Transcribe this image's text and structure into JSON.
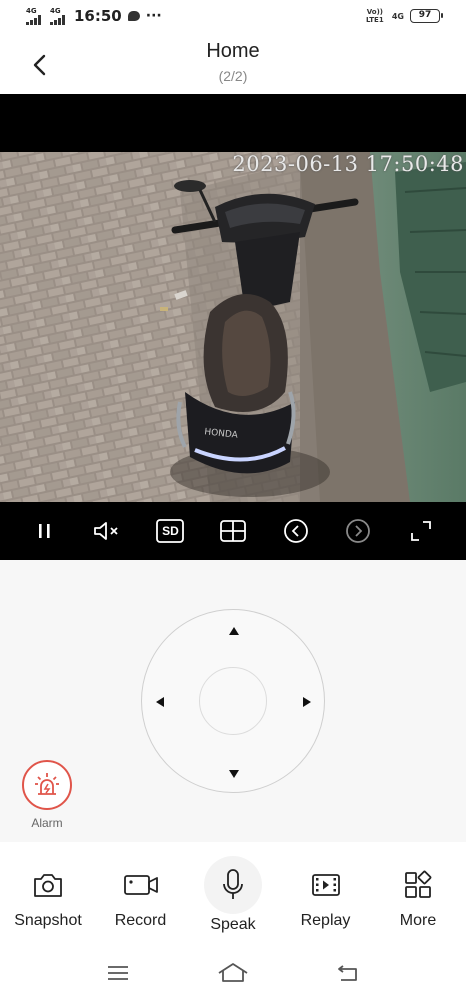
{
  "status_bar": {
    "signal1_label": "4G",
    "signal2_label": "4G",
    "time": "16:50",
    "more_dots": "···",
    "volte_label": "Vo)) LTE1",
    "net_label": "4G",
    "battery": "97"
  },
  "header": {
    "title": "Home",
    "subtitle": "(2/2)"
  },
  "video": {
    "timestamp": "2023-06-13  17:50:48",
    "scene": "Honda motorcycle parked on brick pavement next to a green wall",
    "controls": [
      "pause",
      "mute",
      "sd-quality",
      "grid-view",
      "previous-camera",
      "next-camera",
      "fullscreen"
    ],
    "quality_label": "SD"
  },
  "ptz": {
    "alarm_label": "Alarm"
  },
  "toolbar": {
    "items": [
      {
        "label": "Snapshot",
        "icon": "camera-icon"
      },
      {
        "label": "Record",
        "icon": "video-camera-icon"
      },
      {
        "label": "Speak",
        "icon": "microphone-icon"
      },
      {
        "label": "Replay",
        "icon": "film-icon"
      },
      {
        "label": "More",
        "icon": "grid-shapes-icon"
      }
    ]
  },
  "colors": {
    "accent_alarm": "#e0554a",
    "video_bg": "#000000",
    "ptz_bg": "#f7f7f7"
  }
}
